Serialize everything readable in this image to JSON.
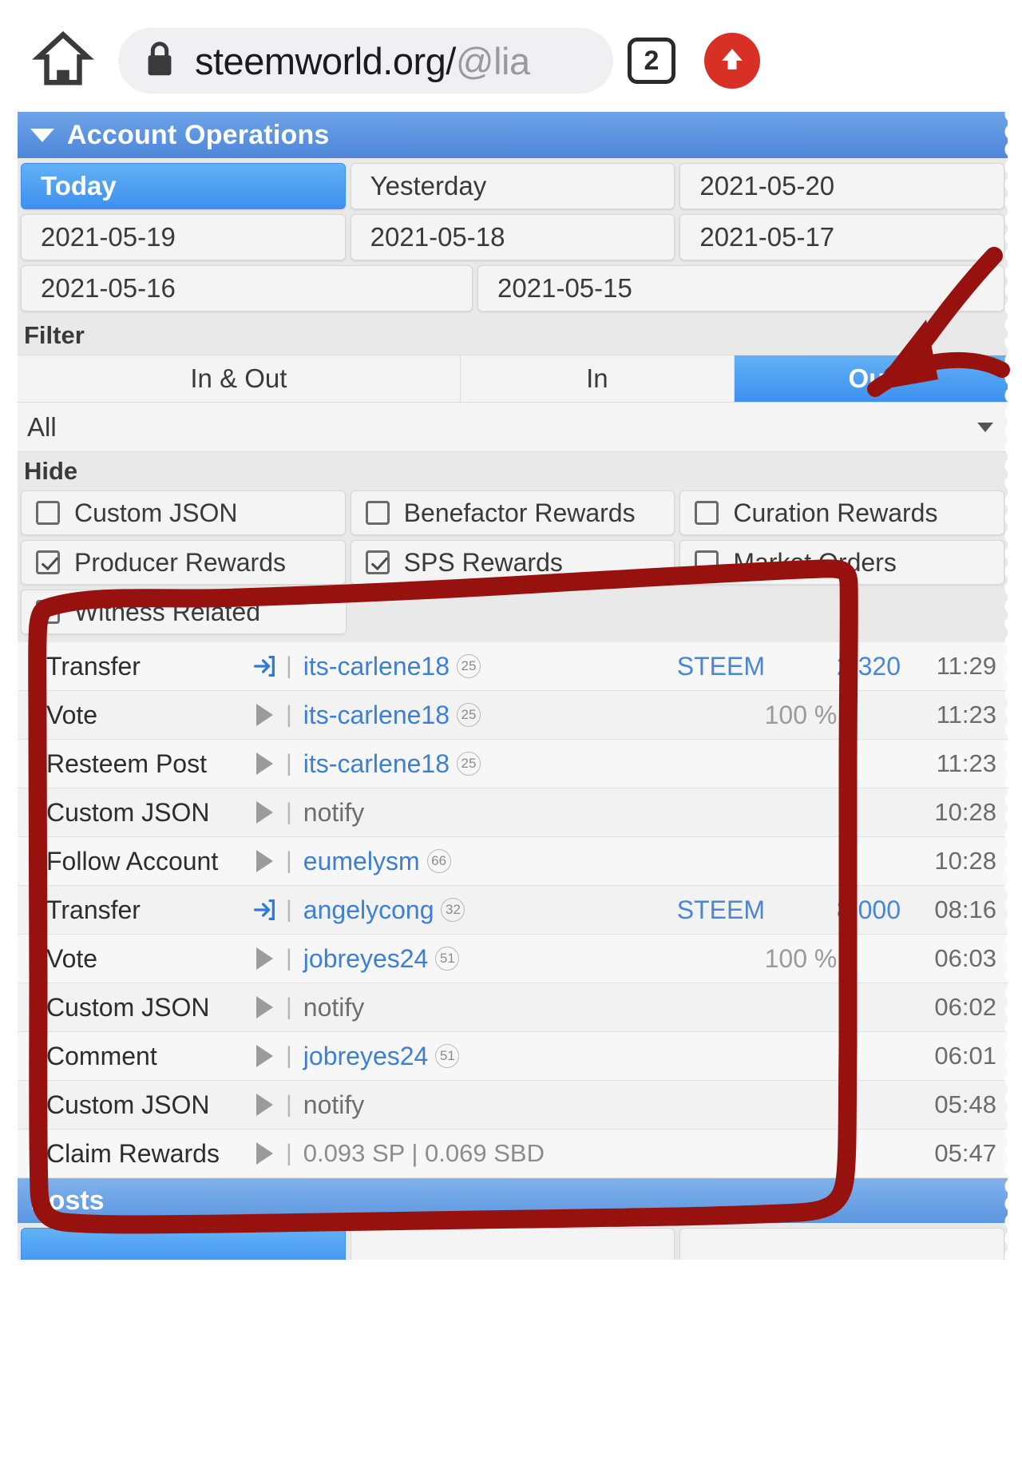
{
  "browser": {
    "home_icon": "home-icon",
    "lock_icon": "lock-icon",
    "url_visible": "steemworld.org/@lia",
    "url_prefix": "steemworld.org/",
    "url_suffix": "@lia",
    "tab_count": "2",
    "upload_icon": "upload-arrow-icon"
  },
  "account_operations": {
    "title": "Account Operations",
    "dates": [
      {
        "label": "Today",
        "active": true
      },
      {
        "label": "Yesterday",
        "active": false
      },
      {
        "label": "2021-05-20",
        "active": false
      },
      {
        "label": "2021-05-19",
        "active": false
      },
      {
        "label": "2021-05-18",
        "active": false
      },
      {
        "label": "2021-05-17",
        "active": false
      },
      {
        "label": "2021-05-16",
        "active": false
      },
      {
        "label": "2021-05-15",
        "active": false
      }
    ],
    "filter_label": "Filter",
    "direction_options": [
      {
        "label": "In & Out",
        "active": false
      },
      {
        "label": "In",
        "active": false
      },
      {
        "label": "Out",
        "active": true
      }
    ],
    "type_select": {
      "value": "All"
    },
    "hide_label": "Hide",
    "hide_options": [
      {
        "label": "Custom JSON",
        "checked": false
      },
      {
        "label": "Benefactor Rewards",
        "checked": false
      },
      {
        "label": "Curation Rewards",
        "checked": false
      },
      {
        "label": "Producer Rewards",
        "checked": true
      },
      {
        "label": "SPS Rewards",
        "checked": true
      },
      {
        "label": "Market Orders",
        "checked": false
      },
      {
        "label": "Witness Related",
        "checked": false
      }
    ],
    "operations": [
      {
        "type": "Transfer",
        "icon": "transfer-in-icon",
        "account": "its-carlene18",
        "reputation": "25",
        "percent": "",
        "currency": "STEEM",
        "amount": "2.320",
        "reward": "",
        "time": "11:29"
      },
      {
        "type": "Vote",
        "icon": "play-triangle-icon",
        "account": "its-carlene18",
        "reputation": "25",
        "percent": "100 %",
        "currency": "",
        "amount": "",
        "reward": "",
        "time": "11:23"
      },
      {
        "type": "Resteem Post",
        "icon": "play-triangle-icon",
        "account": "its-carlene18",
        "reputation": "25",
        "percent": "",
        "currency": "",
        "amount": "",
        "reward": "",
        "time": "11:23"
      },
      {
        "type": "Custom JSON",
        "icon": "play-triangle-icon",
        "account": "notify",
        "reputation": "",
        "percent": "",
        "currency": "",
        "amount": "",
        "reward": "",
        "time": "10:28"
      },
      {
        "type": "Follow Account",
        "icon": "play-triangle-icon",
        "account": "eumelysm",
        "reputation": "66",
        "percent": "",
        "currency": "",
        "amount": "",
        "reward": "",
        "time": "10:28"
      },
      {
        "type": "Transfer",
        "icon": "transfer-in-icon",
        "account": "angelycong",
        "reputation": "32",
        "percent": "",
        "currency": "STEEM",
        "amount": "8.000",
        "reward": "",
        "time": "08:16"
      },
      {
        "type": "Vote",
        "icon": "play-triangle-icon",
        "account": "jobreyes24",
        "reputation": "51",
        "percent": "100 %",
        "currency": "",
        "amount": "",
        "reward": "",
        "time": "06:03"
      },
      {
        "type": "Custom JSON",
        "icon": "play-triangle-icon",
        "account": "notify",
        "reputation": "",
        "percent": "",
        "currency": "",
        "amount": "",
        "reward": "",
        "time": "06:02"
      },
      {
        "type": "Comment",
        "icon": "play-triangle-icon",
        "account": "jobreyes24",
        "reputation": "51",
        "percent": "",
        "currency": "",
        "amount": "",
        "reward": "",
        "time": "06:01"
      },
      {
        "type": "Custom JSON",
        "icon": "play-triangle-icon",
        "account": "notify",
        "reputation": "",
        "percent": "",
        "currency": "",
        "amount": "",
        "reward": "",
        "time": "05:48"
      },
      {
        "type": "Claim Rewards",
        "icon": "play-triangle-icon",
        "account": "",
        "reputation": "",
        "percent": "",
        "currency": "",
        "amount": "",
        "reward": "0.093 SP | 0.069 SBD",
        "time": "05:47"
      }
    ]
  },
  "posts_section": {
    "title": "Posts"
  },
  "annotation": {
    "color": "#97120f",
    "shapes": [
      "arrow-pointing-to-out-button",
      "rectangle-circling-operations-list"
    ]
  }
}
